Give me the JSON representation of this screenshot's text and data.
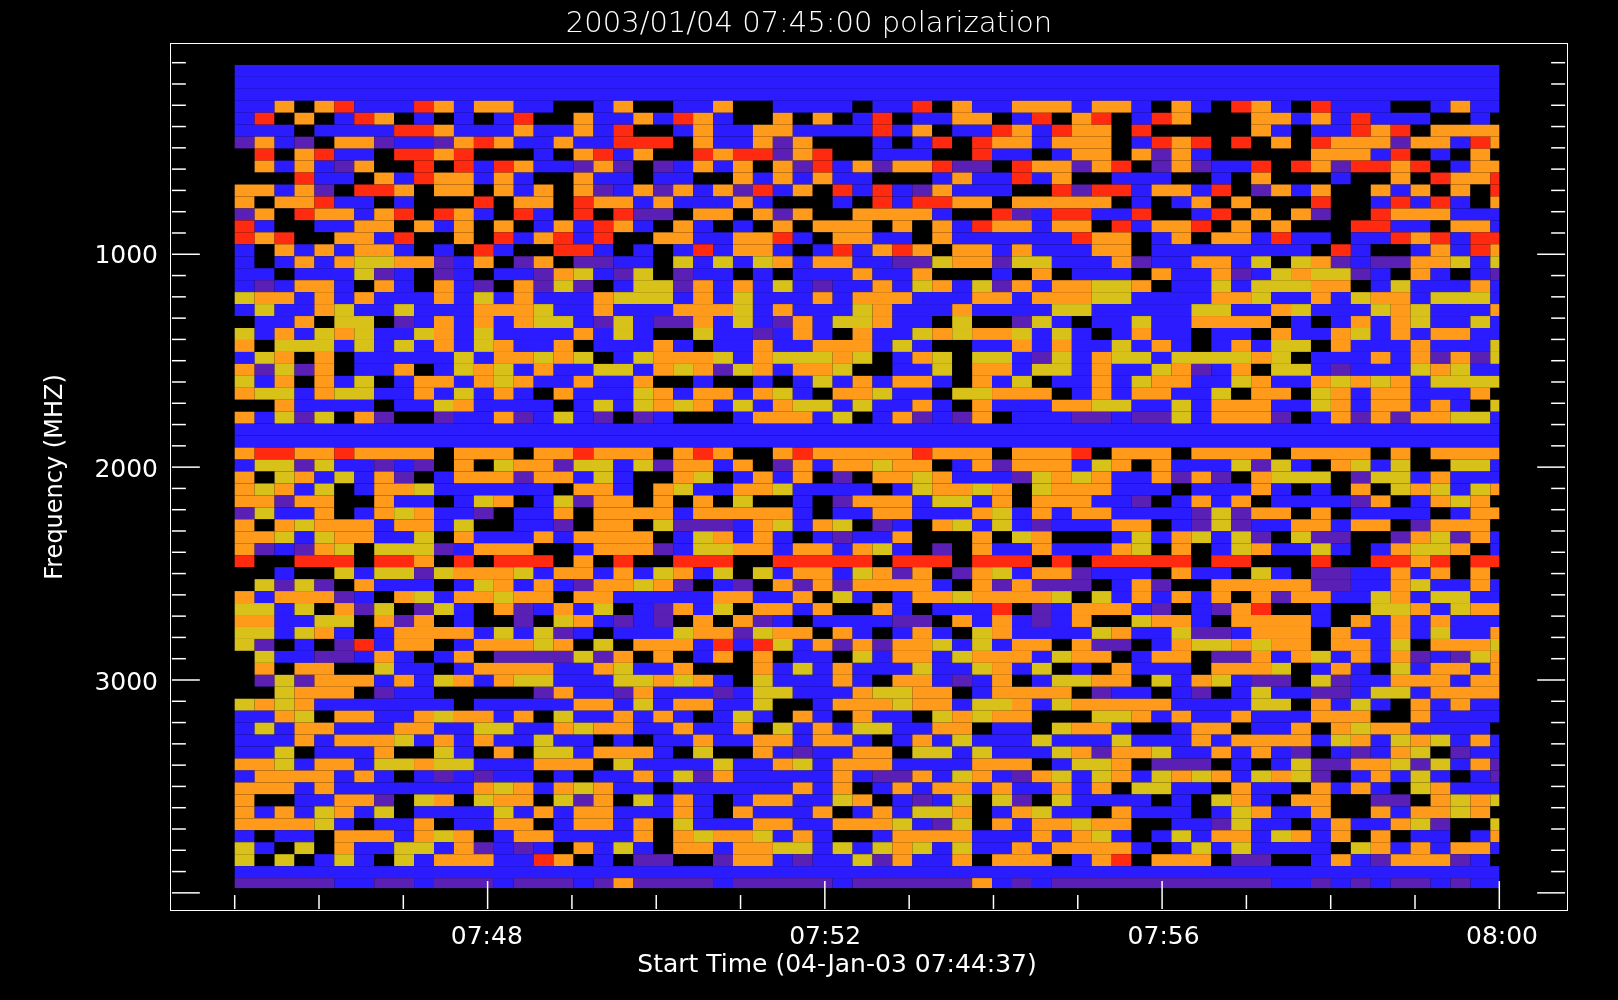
{
  "title": "2003/01/04 07:45:00 polarization",
  "y_axis": {
    "label": "Frequency (MHZ)",
    "ticks": [
      "1000",
      "2000",
      "3000"
    ]
  },
  "x_axis": {
    "label": "Start Time (04-Jan-03 07:44:37)",
    "ticks": [
      "07:48",
      "07:52",
      "07:56",
      "08:00"
    ]
  }
}
